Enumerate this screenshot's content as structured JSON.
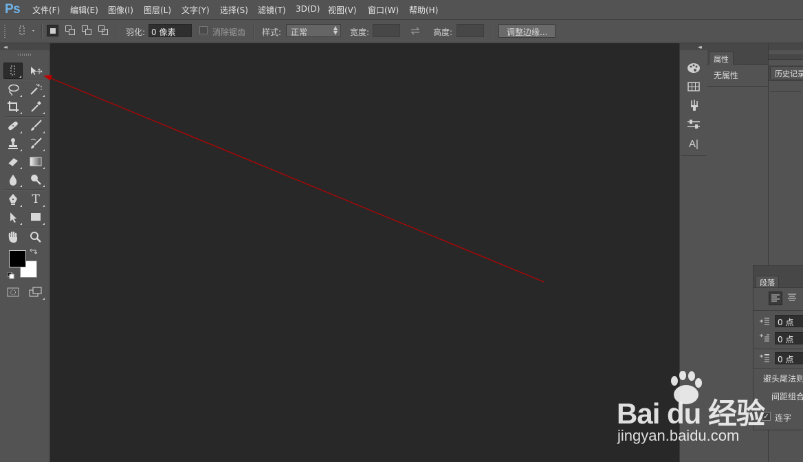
{
  "app": {
    "logo": "Ps"
  },
  "menu": [
    "文件(F)",
    "编辑(E)",
    "图像(I)",
    "图层(L)",
    "文字(Y)",
    "选择(S)",
    "滤镜(T)",
    "3D(D)",
    "视图(V)",
    "窗口(W)",
    "帮助(H)"
  ],
  "options": {
    "feather_label": "羽化:",
    "feather_value": "0 像素",
    "antialias_label": "消除锯齿",
    "style_label": "样式:",
    "style_value": "正常",
    "width_label": "宽度:",
    "height_label": "高度:",
    "refine_edge_button": "调整边缘..."
  },
  "tools": {
    "collapse": "◂◂",
    "type_tool_glyph": "T"
  },
  "iconstrip": {
    "collapse": "◂◂",
    "character_glyph": "A|"
  },
  "properties": {
    "tab": "属性",
    "content": "无属性"
  },
  "history": {
    "tab": "历史记录"
  },
  "paragraph": {
    "tab": "段落",
    "indent_left": "0 点",
    "indent_first": "0 点",
    "space_before": "0 点",
    "kinsoku_label": "避头尾法则",
    "mojikumi_label": "间距组合",
    "hyphenate_label": "连字",
    "hyphenate_checked": "✓"
  },
  "watermark": {
    "brand": "Bai du 经验",
    "url": "jingyan.baidu.com"
  },
  "annotation": {
    "color": "#c00000"
  },
  "colors": {
    "foreground": "#000000",
    "background": "#ffffff",
    "logo": "#6fb3e8"
  }
}
